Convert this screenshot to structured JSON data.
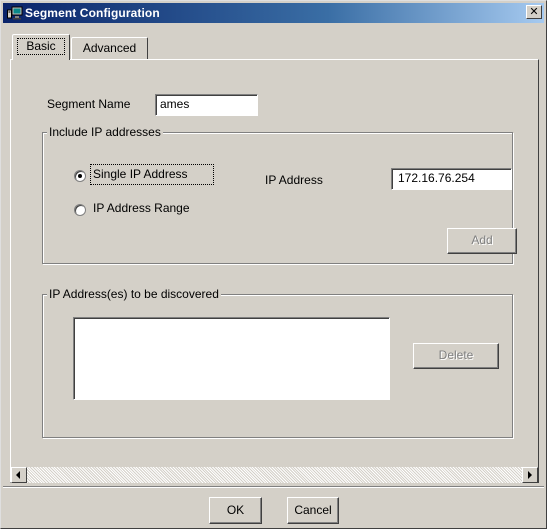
{
  "window": {
    "title": "Segment Configuration",
    "close_glyph": "✕"
  },
  "tabs": [
    {
      "label": "Basic",
      "selected": true
    },
    {
      "label": "Advanced",
      "selected": false
    }
  ],
  "segment": {
    "name_label": "Segment Name",
    "name_value": "ames"
  },
  "include_group": {
    "title": "Include IP addresses",
    "single_label": "Single IP Address",
    "range_label": "IP Address  Range",
    "selected_option": "Single IP Address",
    "ip_label": "IP Address",
    "ip_value": "172.16.76.254",
    "add_label": "Add"
  },
  "discover_group": {
    "title": "IP Address(es) to be discovered",
    "items": [],
    "delete_label": "Delete"
  },
  "footer": {
    "ok_label": "OK",
    "cancel_label": "Cancel"
  },
  "icons": {
    "title_icon": "network-computer-icon",
    "close": "close-icon",
    "scroll_left": "scroll-left-arrow-icon",
    "scroll_right": "scroll-right-arrow-icon"
  },
  "colors": {
    "titlebar_start": "#0a246a",
    "titlebar_end": "#a6caf0",
    "face": "#d4d0c8"
  }
}
